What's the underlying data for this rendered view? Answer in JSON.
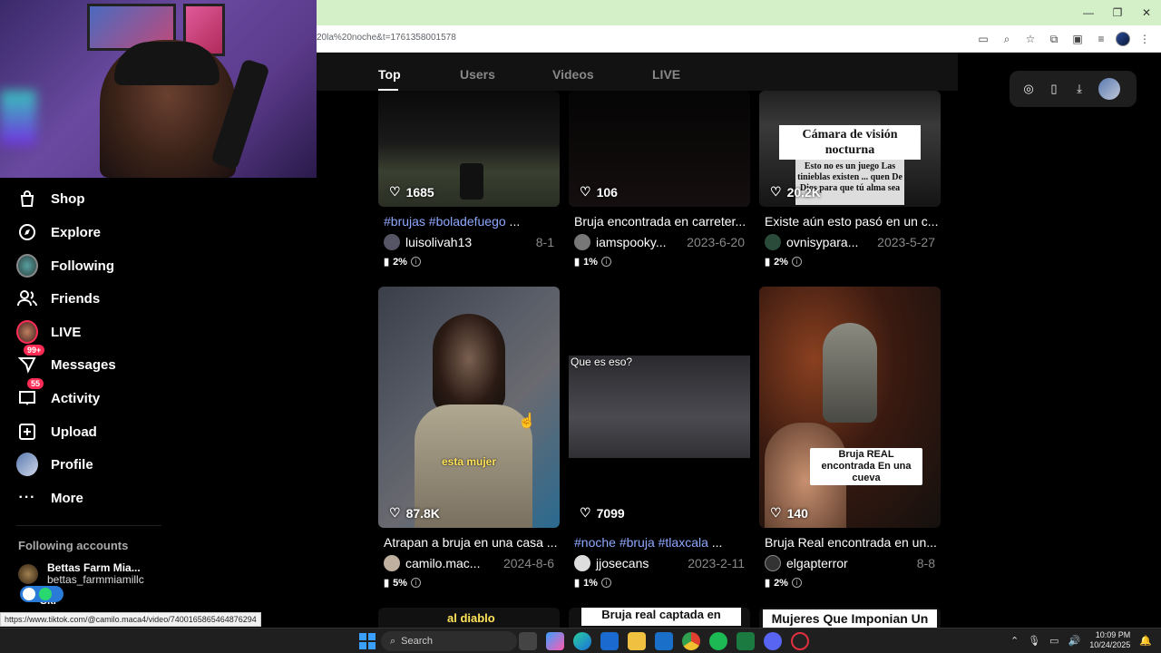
{
  "browser": {
    "url": "20la%20noche&t=1761358001578",
    "window_controls": [
      "minimize",
      "restore",
      "close"
    ]
  },
  "sidebar": {
    "items": [
      {
        "label": "Shop",
        "icon": "shop-bag-icon"
      },
      {
        "label": "Explore",
        "icon": "compass-icon"
      },
      {
        "label": "Following",
        "icon": "following-avatar"
      },
      {
        "label": "Friends",
        "icon": "friends-icon"
      },
      {
        "label": "LIVE",
        "icon": "live-avatar"
      },
      {
        "label": "Messages",
        "icon": "messages-icon",
        "badge": "99+"
      },
      {
        "label": "Activity",
        "icon": "activity-icon",
        "badge": "55"
      },
      {
        "label": "Upload",
        "icon": "upload-icon"
      },
      {
        "label": "Profile",
        "icon": "profile-avatar"
      },
      {
        "label": "More",
        "icon": "more-icon"
      }
    ],
    "following_title": "Following accounts",
    "accounts": [
      {
        "name": "Bettas Farm Mia...",
        "handle": "bettas_farmmiamillc"
      },
      {
        "name": "Ski",
        "handle": ""
      }
    ]
  },
  "tabs": [
    {
      "label": "Top",
      "active": true
    },
    {
      "label": "Users",
      "active": false
    },
    {
      "label": "Videos",
      "active": false
    },
    {
      "label": "LIVE",
      "active": false
    }
  ],
  "videos": [
    {
      "likes": "1685",
      "caption_tags": "#brujas #boladefuego",
      "caption_text": " ...",
      "user": "luisolivah13",
      "date": "8-1",
      "pct": "2%"
    },
    {
      "likes": "106",
      "caption_tags": "",
      "caption_text": "Bruja encontrada en carreter...",
      "user": "iamspooky...",
      "date": "2023-6-20",
      "pct": "1%"
    },
    {
      "likes": "20.2K",
      "caption_tags": "",
      "caption_text": "Existe aún esto pasó en un c...",
      "user": "ovnisypara...",
      "date": "2023-5-27",
      "pct": "2%",
      "overlay_title": "Cámara de visión nocturna",
      "overlay_sub": "Esto no es un juego Las tinieblas existen ... quen De Dios para que tú alma sea"
    },
    {
      "likes": "87.8K",
      "caption_tags": "",
      "caption_text": "Atrapan a bruja en una casa ...",
      "user": "camilo.mac...",
      "date": "2024-8-6",
      "pct": "5%",
      "overlay": "esta mujer"
    },
    {
      "likes": "7099",
      "caption_tags": "#noche #bruja #tlaxcala",
      "caption_text": " ...",
      "user": "jjosecans",
      "date": "2023-2-11",
      "pct": "1%",
      "overlay": "Que es eso?"
    },
    {
      "likes": "140",
      "caption_tags": "",
      "caption_text": "Bruja Real encontrada en un...",
      "user": "elgapterror",
      "date": "8-8",
      "pct": "2%",
      "overlay": "Bruja REAL encontrada En una cueva"
    }
  ],
  "bottom_row": [
    "al diablo",
    "Bruja real captada en",
    "Mujeres Que Imponian Un"
  ],
  "status_url": "https://www.tiktok.com/@camilo.maca4/video/7400165865464876294",
  "taskbar": {
    "search_placeholder": "Search",
    "time": "10:09 PM",
    "date": "10/24/2025"
  }
}
